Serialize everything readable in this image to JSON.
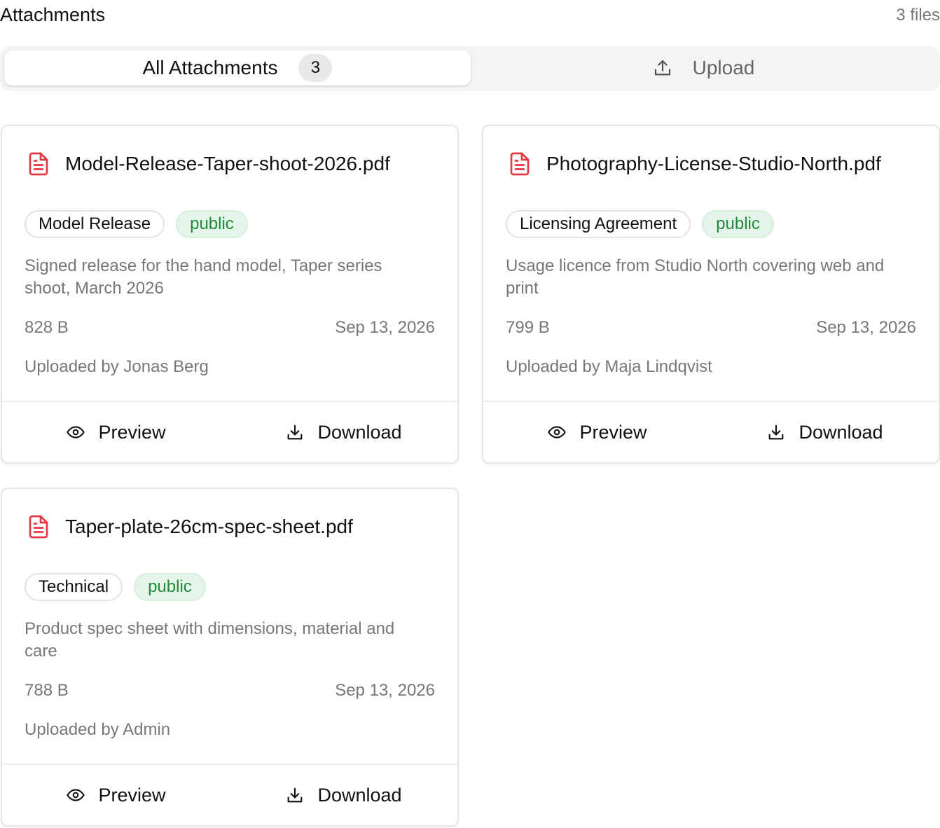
{
  "header": {
    "title": "Attachments",
    "count_label": "3 files"
  },
  "tabs": {
    "all_label": "All Attachments",
    "all_count": "3",
    "upload_label": "Upload"
  },
  "icons": {
    "file": "file-text-icon",
    "upload": "upload-icon",
    "preview": "eye-icon",
    "download": "download-icon"
  },
  "colors": {
    "file_icon": "#e53945",
    "public_tag_text": "#1f8a3a",
    "public_tag_bg": "#e5f5e9"
  },
  "attachments": [
    {
      "file_name": "Model-Release-Taper-shoot-2026.pdf",
      "category": "Model Release",
      "visibility": "public",
      "description": "Signed release for the hand model, Taper series shoot, March 2026",
      "size": "828 B",
      "date": "Sep 13, 2026",
      "uploader": "Uploaded by Jonas Berg",
      "preview_label": "Preview",
      "download_label": "Download"
    },
    {
      "file_name": "Photography-License-Studio-North.pdf",
      "category": "Licensing Agreement",
      "visibility": "public",
      "description": "Usage licence from Studio North covering web and print",
      "size": "799 B",
      "date": "Sep 13, 2026",
      "uploader": "Uploaded by Maja Lindqvist",
      "preview_label": "Preview",
      "download_label": "Download"
    },
    {
      "file_name": "Taper-plate-26cm-spec-sheet.pdf",
      "category": "Technical",
      "visibility": "public",
      "description": "Product spec sheet with dimensions, material and care",
      "size": "788 B",
      "date": "Sep 13, 2026",
      "uploader": "Uploaded by Admin",
      "preview_label": "Preview",
      "download_label": "Download"
    }
  ]
}
